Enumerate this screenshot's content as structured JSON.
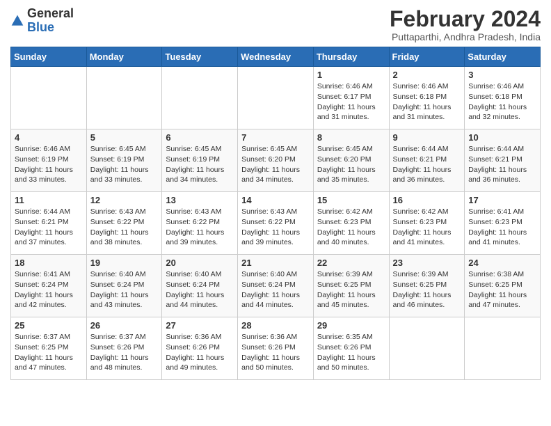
{
  "header": {
    "logo_general": "General",
    "logo_blue": "Blue",
    "month_title": "February 2024",
    "location": "Puttaparthi, Andhra Pradesh, India"
  },
  "weekdays": [
    "Sunday",
    "Monday",
    "Tuesday",
    "Wednesday",
    "Thursday",
    "Friday",
    "Saturday"
  ],
  "weeks": [
    [
      {
        "day": "",
        "info": ""
      },
      {
        "day": "",
        "info": ""
      },
      {
        "day": "",
        "info": ""
      },
      {
        "day": "",
        "info": ""
      },
      {
        "day": "1",
        "info": "Sunrise: 6:46 AM\nSunset: 6:17 PM\nDaylight: 11 hours and 31 minutes."
      },
      {
        "day": "2",
        "info": "Sunrise: 6:46 AM\nSunset: 6:18 PM\nDaylight: 11 hours and 31 minutes."
      },
      {
        "day": "3",
        "info": "Sunrise: 6:46 AM\nSunset: 6:18 PM\nDaylight: 11 hours and 32 minutes."
      }
    ],
    [
      {
        "day": "4",
        "info": "Sunrise: 6:46 AM\nSunset: 6:19 PM\nDaylight: 11 hours and 33 minutes."
      },
      {
        "day": "5",
        "info": "Sunrise: 6:45 AM\nSunset: 6:19 PM\nDaylight: 11 hours and 33 minutes."
      },
      {
        "day": "6",
        "info": "Sunrise: 6:45 AM\nSunset: 6:19 PM\nDaylight: 11 hours and 34 minutes."
      },
      {
        "day": "7",
        "info": "Sunrise: 6:45 AM\nSunset: 6:20 PM\nDaylight: 11 hours and 34 minutes."
      },
      {
        "day": "8",
        "info": "Sunrise: 6:45 AM\nSunset: 6:20 PM\nDaylight: 11 hours and 35 minutes."
      },
      {
        "day": "9",
        "info": "Sunrise: 6:44 AM\nSunset: 6:21 PM\nDaylight: 11 hours and 36 minutes."
      },
      {
        "day": "10",
        "info": "Sunrise: 6:44 AM\nSunset: 6:21 PM\nDaylight: 11 hours and 36 minutes."
      }
    ],
    [
      {
        "day": "11",
        "info": "Sunrise: 6:44 AM\nSunset: 6:21 PM\nDaylight: 11 hours and 37 minutes."
      },
      {
        "day": "12",
        "info": "Sunrise: 6:43 AM\nSunset: 6:22 PM\nDaylight: 11 hours and 38 minutes."
      },
      {
        "day": "13",
        "info": "Sunrise: 6:43 AM\nSunset: 6:22 PM\nDaylight: 11 hours and 39 minutes."
      },
      {
        "day": "14",
        "info": "Sunrise: 6:43 AM\nSunset: 6:22 PM\nDaylight: 11 hours and 39 minutes."
      },
      {
        "day": "15",
        "info": "Sunrise: 6:42 AM\nSunset: 6:23 PM\nDaylight: 11 hours and 40 minutes."
      },
      {
        "day": "16",
        "info": "Sunrise: 6:42 AM\nSunset: 6:23 PM\nDaylight: 11 hours and 41 minutes."
      },
      {
        "day": "17",
        "info": "Sunrise: 6:41 AM\nSunset: 6:23 PM\nDaylight: 11 hours and 41 minutes."
      }
    ],
    [
      {
        "day": "18",
        "info": "Sunrise: 6:41 AM\nSunset: 6:24 PM\nDaylight: 11 hours and 42 minutes."
      },
      {
        "day": "19",
        "info": "Sunrise: 6:40 AM\nSunset: 6:24 PM\nDaylight: 11 hours and 43 minutes."
      },
      {
        "day": "20",
        "info": "Sunrise: 6:40 AM\nSunset: 6:24 PM\nDaylight: 11 hours and 44 minutes."
      },
      {
        "day": "21",
        "info": "Sunrise: 6:40 AM\nSunset: 6:24 PM\nDaylight: 11 hours and 44 minutes."
      },
      {
        "day": "22",
        "info": "Sunrise: 6:39 AM\nSunset: 6:25 PM\nDaylight: 11 hours and 45 minutes."
      },
      {
        "day": "23",
        "info": "Sunrise: 6:39 AM\nSunset: 6:25 PM\nDaylight: 11 hours and 46 minutes."
      },
      {
        "day": "24",
        "info": "Sunrise: 6:38 AM\nSunset: 6:25 PM\nDaylight: 11 hours and 47 minutes."
      }
    ],
    [
      {
        "day": "25",
        "info": "Sunrise: 6:37 AM\nSunset: 6:25 PM\nDaylight: 11 hours and 47 minutes."
      },
      {
        "day": "26",
        "info": "Sunrise: 6:37 AM\nSunset: 6:26 PM\nDaylight: 11 hours and 48 minutes."
      },
      {
        "day": "27",
        "info": "Sunrise: 6:36 AM\nSunset: 6:26 PM\nDaylight: 11 hours and 49 minutes."
      },
      {
        "day": "28",
        "info": "Sunrise: 6:36 AM\nSunset: 6:26 PM\nDaylight: 11 hours and 50 minutes."
      },
      {
        "day": "29",
        "info": "Sunrise: 6:35 AM\nSunset: 6:26 PM\nDaylight: 11 hours and 50 minutes."
      },
      {
        "day": "",
        "info": ""
      },
      {
        "day": "",
        "info": ""
      }
    ]
  ]
}
